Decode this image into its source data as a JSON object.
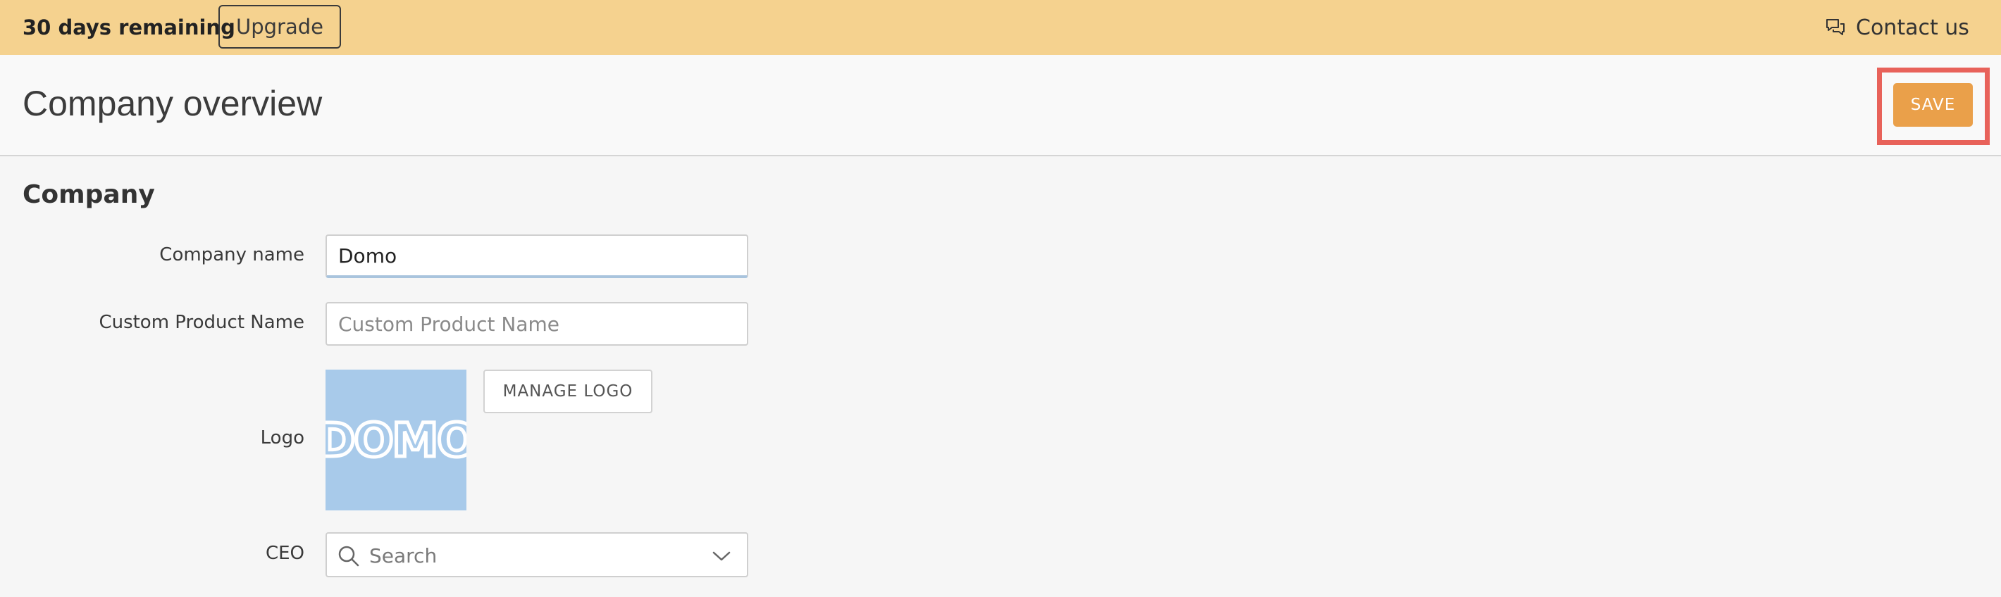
{
  "banner": {
    "trial_text": "30 days remaining",
    "upgrade_label": "Upgrade",
    "contact_label": "Contact us",
    "contact_icon": "chat-bubbles-icon",
    "background_color": "#f5d28f"
  },
  "header": {
    "title": "Company overview",
    "save_label": "SAVE",
    "save_color": "#eaa04a",
    "highlight_color": "#e8625a"
  },
  "company": {
    "section_title": "Company",
    "name_label": "Company name",
    "name_value": "Domo",
    "product_label": "Custom Product Name",
    "product_placeholder": "Custom Product Name",
    "logo_label": "Logo",
    "logo_text": "DOMO",
    "logo_bg_color": "#a8caea",
    "manage_logo_label": "MANAGE LOGO",
    "ceo_label": "CEO",
    "ceo_placeholder": "Search",
    "ceo_icon": "search-icon",
    "ceo_dropdown_icon": "chevron-down-icon"
  }
}
